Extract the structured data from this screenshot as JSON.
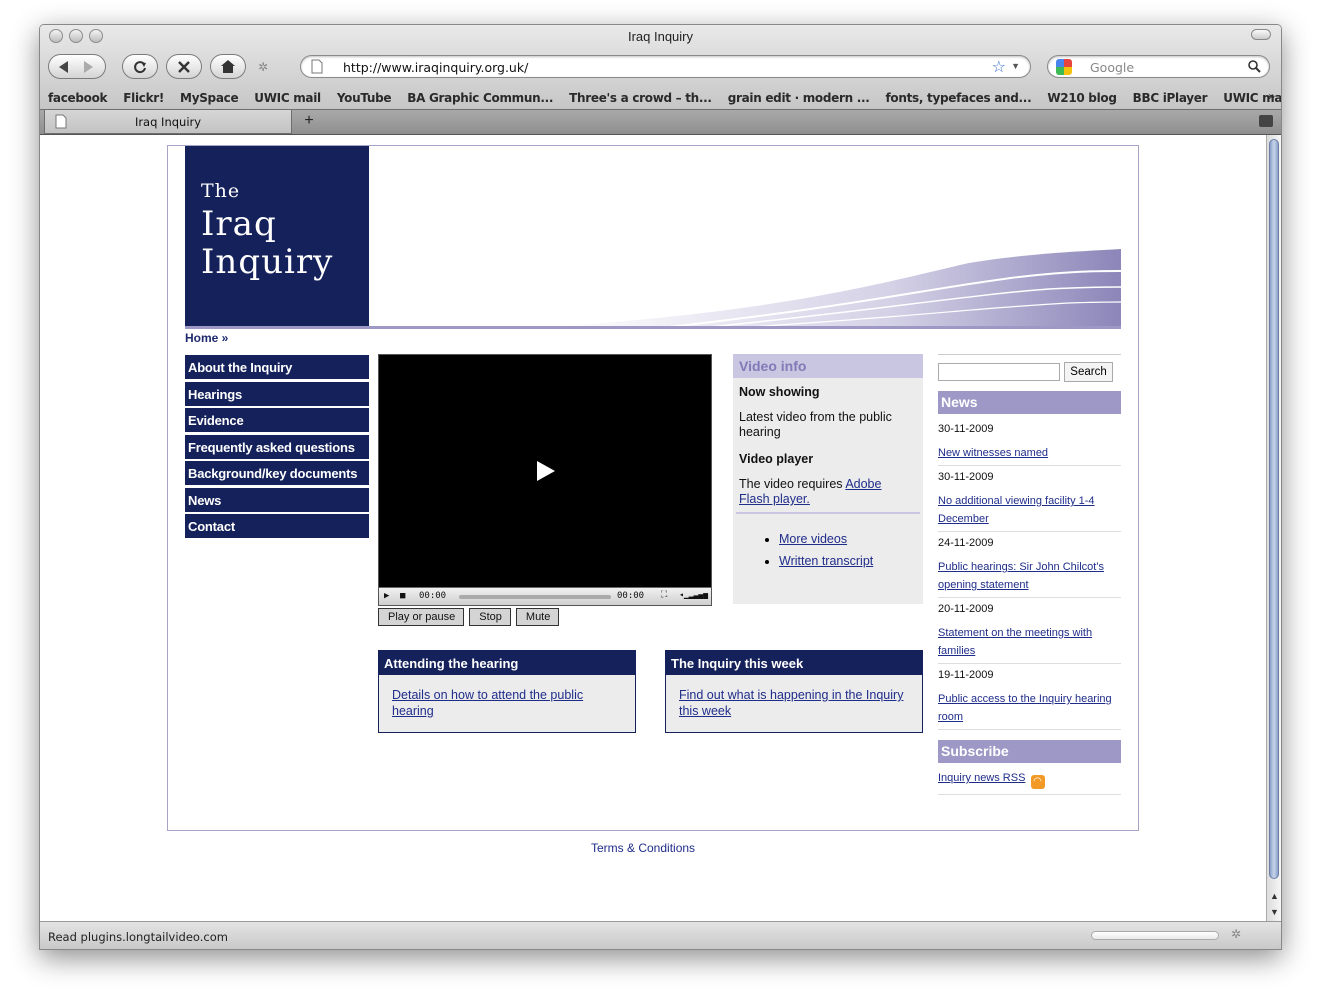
{
  "browser": {
    "window_title": "Iraq Inquiry",
    "url": "http://www.iraqinquiry.org.uk/",
    "search_placeholder": "Google",
    "bookmarks": [
      "facebook",
      "Flickr!",
      "MySpace",
      "UWIC mail",
      "YouTube",
      "BA Graphic Commun...",
      "Three's a crowd – th...",
      "grain edit · modern ...",
      "fonts, typefaces and...",
      "W210 blog",
      "BBC iPlayer",
      "UWIC mail"
    ],
    "bookmarks_more": "»",
    "tab_title": "Iraq Inquiry",
    "new_tab": "+",
    "status_text": "Read plugins.longtailvideo.com"
  },
  "site": {
    "logo": {
      "line1": "The",
      "line2": "Iraq",
      "line3": "Inquiry"
    },
    "breadcrumb": "Home »",
    "nav": [
      "About the Inquiry",
      "Hearings",
      "Evidence",
      "Frequently asked questions",
      "Background/key documents",
      "News",
      "Contact"
    ],
    "video": {
      "time_current": "00:00",
      "time_total": "00:00",
      "buttons": [
        "Play or pause",
        "Stop",
        "Mute"
      ]
    },
    "video_info": {
      "heading": "Video info",
      "now_showing_label": "Now showing",
      "now_showing_text": "Latest video from the public hearing",
      "player_label": "Video player",
      "player_text": "The video requires ",
      "player_link": "Adobe Flash player.",
      "links": [
        "More videos",
        "Written transcript"
      ]
    },
    "boxes": [
      {
        "heading": "Attending the hearing",
        "link": "Details on how to attend the public hearing"
      },
      {
        "heading": "The Inquiry this week",
        "link": "Find out what is happening in the Inquiry this week"
      }
    ],
    "search_button": "Search",
    "news_heading": "News",
    "news": [
      {
        "date": "30-11-2009",
        "title": "New witnesses named"
      },
      {
        "date": "30-11-2009",
        "title": "No additional viewing facility 1-4 December"
      },
      {
        "date": "24-11-2009",
        "title": "Public hearings: Sir John Chilcot's opening statement"
      },
      {
        "date": "20-11-2009",
        "title": "Statement on the meetings with families"
      },
      {
        "date": "19-11-2009",
        "title": "Public access to the Inquiry hearing room"
      }
    ],
    "subscribe_heading": "Subscribe",
    "subscribe_link": "Inquiry news RSS",
    "footer_link": "Terms & Conditions",
    "colors": {
      "navy": "#14215a",
      "lavender": "#9d98c6",
      "link": "#1f2d8a"
    }
  }
}
